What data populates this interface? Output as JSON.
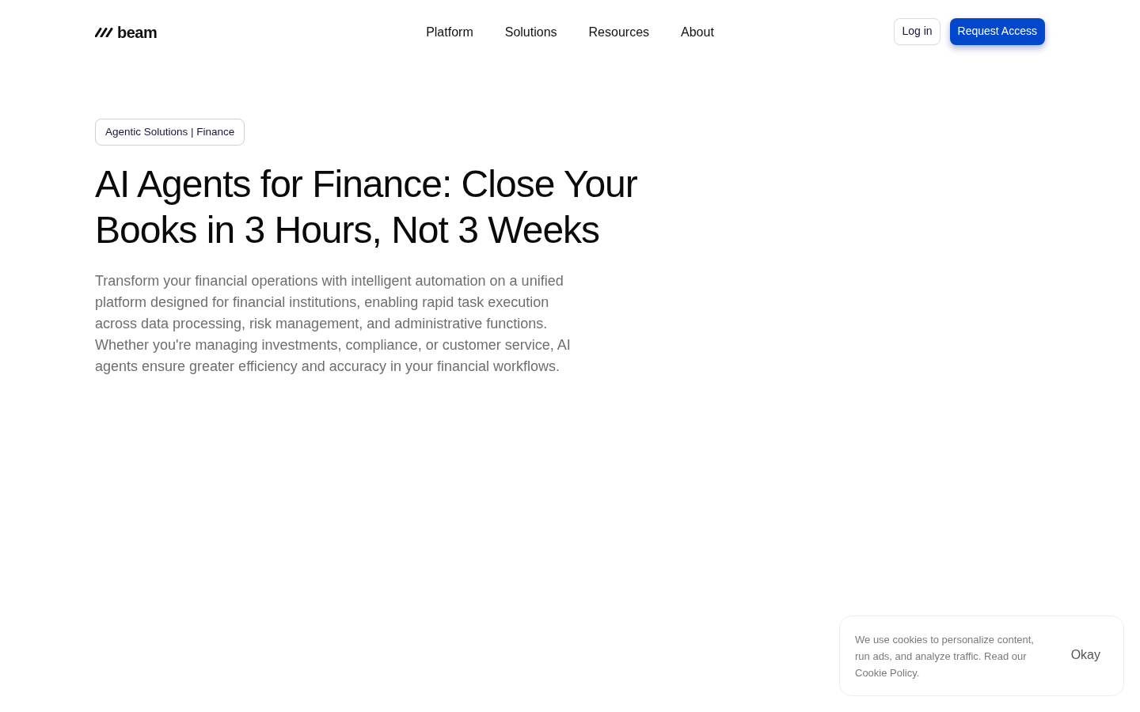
{
  "header": {
    "logo": "beam",
    "nav": [
      "Platform",
      "Solutions",
      "Resources",
      "About"
    ],
    "buttons": [
      {
        "label": "Log in",
        "kind": "secondary"
      },
      {
        "label": "Request Access",
        "kind": "primary"
      }
    ]
  },
  "hero": {
    "badge": "Agentic Solutions | Finance",
    "title": "AI Agents for Finance: Close Your Books in 3 Hours, Not 3 Weeks",
    "description": "Transform your financial operations with intelligent automation on a unified platform designed for financial institutions, enabling rapid task execution across data processing, risk management, and administrative functions. Whether you're managing investments, compliance, or customer service, AI agents ensure greater efficiency and accuracy in your financial workflows."
  },
  "cookie_banner": {
    "text": "We use cookies to personalize content, run ads, and analyze traffic. Read our Cookie Policy.",
    "button": "Okay"
  }
}
